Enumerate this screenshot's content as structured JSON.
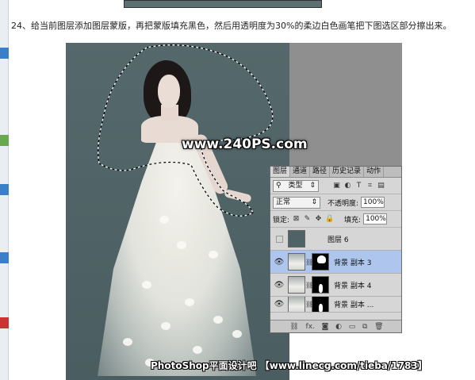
{
  "instruction": {
    "text": "24、给当前图层添加图层蒙版，再把蒙版填充黑色，然后用透明度为30%的柔边白色画笔把下图选区部分擦出来。"
  },
  "watermark": {
    "text": "www.240PS.com"
  },
  "credit": {
    "text": "PhotoShop平面设计吧 【www.linecg.com/tieba/1783】"
  },
  "layers_panel": {
    "tabs": [
      "图层",
      "通道",
      "路径",
      "历史记录",
      "动作"
    ],
    "active_tab": "图层",
    "filter_label": "类型",
    "filter_icons": [
      "image-filter-icon",
      "adjustment-filter-icon",
      "text-filter-icon",
      "shape-filter-icon",
      "smart-object-filter-icon"
    ],
    "blend_mode": "正常",
    "opacity_label": "不透明度:",
    "opacity_value": "100%",
    "lock_label": "锁定:",
    "fill_label": "填充:",
    "fill_value": "100%",
    "layers": [
      {
        "name": "图层 6",
        "visible": false,
        "has_mask": false,
        "selected": false
      },
      {
        "name": "背景 副本 3",
        "visible": true,
        "has_mask": true,
        "selected": true
      },
      {
        "name": "背景 副本 4",
        "visible": true,
        "has_mask": true,
        "selected": false
      },
      {
        "name": "背景 副本 ...",
        "visible": true,
        "has_mask": true,
        "selected": false
      }
    ],
    "bottom_icons": [
      "link-icon",
      "fx-icon",
      "mask-icon",
      "adjustment-icon",
      "folder-icon",
      "new-layer-icon",
      "trash-icon"
    ],
    "fx_label": "fx."
  },
  "colors": {
    "photo_background": "#4f6366",
    "selected_layer": "#aec6ee",
    "panel_background": "#d6d6d6"
  }
}
